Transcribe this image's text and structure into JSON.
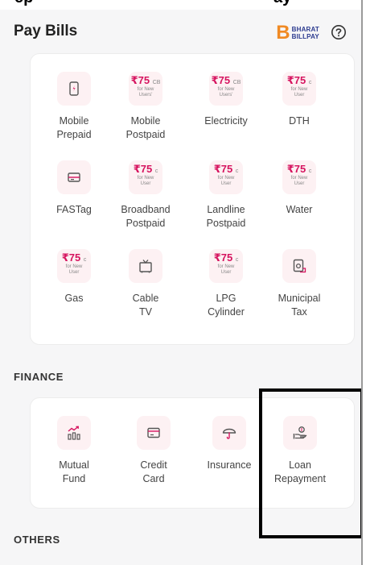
{
  "top_strip": {
    "left_text": "ep",
    "right_text": "ay"
  },
  "header": {
    "title": "Pay Bills",
    "logo_letter": "B",
    "logo_line1": "BHARAT",
    "logo_line2": "BILLPAY"
  },
  "offer_badge": {
    "amount": "₹75",
    "suffix_cb": "CB",
    "suffix_c": "c"
  },
  "bills": [
    {
      "label": "Mobile Prepaid",
      "icon": "mobile-icon"
    },
    {
      "label": "Mobile Postpaid",
      "offer_lines": [
        "for New",
        "Users'"
      ]
    },
    {
      "label": "Electricity",
      "offer_lines": [
        "for New",
        "Users'"
      ]
    },
    {
      "label": "DTH",
      "offer_lines": [
        "for New",
        "User"
      ]
    },
    {
      "label": "FASTag",
      "icon": "fastag-icon"
    },
    {
      "label": "Broadband Postpaid",
      "offer_lines": [
        "for New",
        "User"
      ]
    },
    {
      "label": "Landline Postpaid",
      "offer_lines": [
        "for New",
        "User"
      ]
    },
    {
      "label": "Water",
      "offer_lines": [
        "for New",
        "User"
      ]
    },
    {
      "label": "Gas",
      "offer_lines": [
        "for New",
        "User"
      ]
    },
    {
      "label": "Cable TV",
      "icon": "tv-icon"
    },
    {
      "label": "LPG Cylinder",
      "offer_lines": [
        "for New",
        "User"
      ]
    },
    {
      "label": "Municipal Tax",
      "icon": "municipal-tax-icon"
    }
  ],
  "finance": {
    "title": "FINANCE",
    "items": [
      {
        "label": "Mutual Fund",
        "icon": "mutual-fund-icon"
      },
      {
        "label": "Credit Card",
        "icon": "credit-card-icon"
      },
      {
        "label": "Insurance",
        "icon": "umbrella-icon"
      },
      {
        "label": "Loan Repayment",
        "icon": "loan-hand-icon"
      }
    ]
  },
  "others": {
    "title": "OTHERS"
  },
  "colors": {
    "accent": "#d6145f",
    "icon_bg": "#fdf1f3",
    "logo_orange": "#f08a24",
    "logo_blue": "#2b3a8f"
  }
}
